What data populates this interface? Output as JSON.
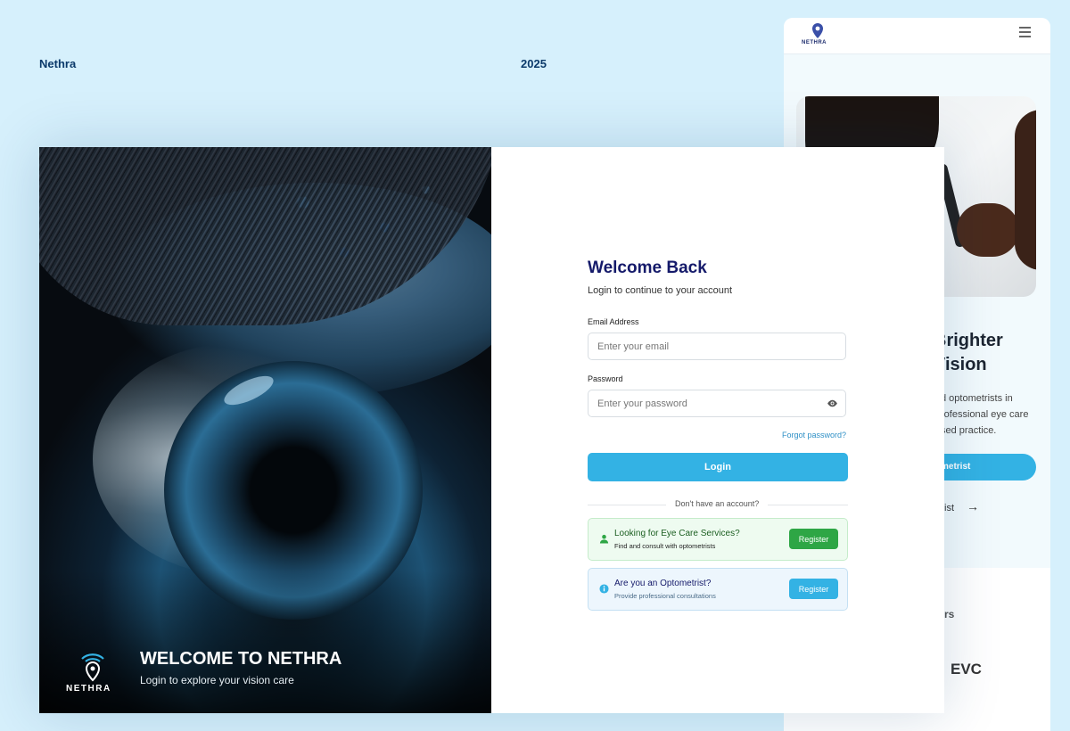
{
  "header": {
    "brand": "Nethra",
    "year": "2025"
  },
  "left_panel": {
    "logo_word": "NETHRA",
    "title": "WELCOME TO NETHRA",
    "subtitle": "Login to explore your vision care"
  },
  "login": {
    "title": "Welcome Back",
    "subtitle": "Login to continue to your account",
    "email_label": "Email Address",
    "email_placeholder": "Enter your email",
    "password_label": "Password",
    "password_placeholder": "Enter your password",
    "forgot_label": "Forgot password?",
    "login_label": "Login",
    "divider_text": "Don't have an account?"
  },
  "register": [
    {
      "title": "Looking for Eye Care Services?",
      "description": "Find and consult with optometrists",
      "button": "Register",
      "icon": "person-icon",
      "color": "#2ea645"
    },
    {
      "title": "Are you an Optometrist?",
      "description": "Provide professional consultations",
      "button": "Register",
      "icon": "info-icon",
      "color": "#33b2e4"
    }
  ],
  "mobile_preview": {
    "logo_word": "NETHRA",
    "heading_line1": "Brighter",
    "heading_line2": "Vision",
    "text_line1": "d optometrists in",
    "text_line2": "rofessional eye care",
    "text_line3": "sed practice.",
    "cta_label": "metrist",
    "link_label": "ist",
    "footer_label1": "rs",
    "footer_label2": "EVC"
  },
  "colors": {
    "background": "#d6f0fc",
    "accent": "#33b2e4",
    "title": "#151a6a",
    "success": "#2ea645"
  }
}
